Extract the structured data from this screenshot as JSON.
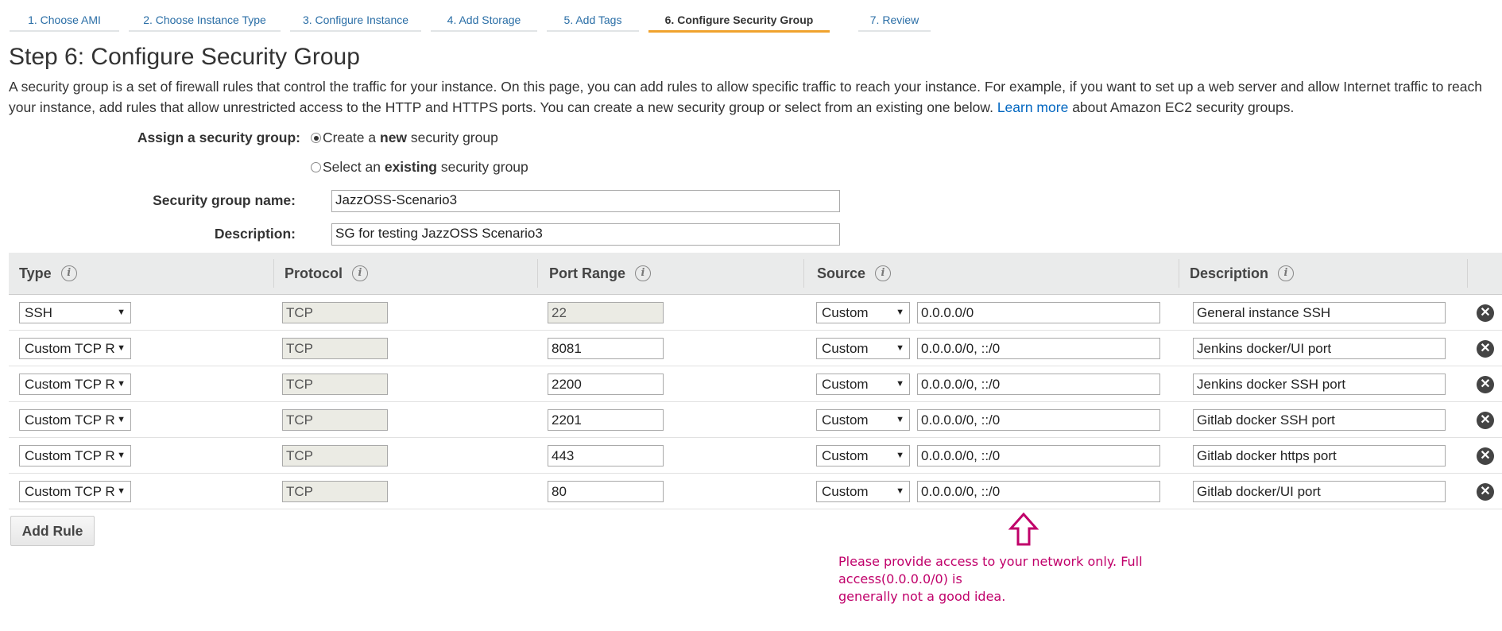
{
  "wizard": {
    "tabs": [
      {
        "label": "1. Choose AMI",
        "active": false
      },
      {
        "label": "2. Choose Instance Type",
        "active": false
      },
      {
        "label": "3. Configure Instance",
        "active": false
      },
      {
        "label": "4. Add Storage",
        "active": false
      },
      {
        "label": "5. Add Tags",
        "active": false
      },
      {
        "label": "6. Configure Security Group",
        "active": true
      },
      {
        "label": "7. Review",
        "active": false
      }
    ],
    "active_color": "#f0a32e"
  },
  "page": {
    "title": "Step 6: Configure Security Group",
    "intro_line1": "A security group is a set of firewall rules that control the traffic for your instance. On this page, you can add rules to allow specific traffic to reach your instance. For example, if you want to set up a web server and allow Internet traffic to reach",
    "intro_line2": "your instance, add rules that allow unrestricted access to the HTTP and HTTPS ports. You can create a new security group or select from an existing one below.",
    "learn_more": "Learn more",
    "intro_tail": "about Amazon EC2 security groups."
  },
  "assign": {
    "label": "Assign a security group:",
    "option_new_pre": "Create a ",
    "option_new_bold": "new",
    "option_new_post": " security group",
    "option_existing_pre": "Select an ",
    "option_existing_bold": "existing",
    "option_existing_post": " security group",
    "selected": "new"
  },
  "form": {
    "name_label": "Security group name:",
    "name_value": "JazzOSS-Scenario3",
    "desc_label": "Description:",
    "desc_value": "SG for testing JazzOSS Scenario3"
  },
  "table": {
    "headers": {
      "type": "Type",
      "protocol": "Protocol",
      "port_range": "Port Range",
      "source": "Source",
      "description": "Description"
    },
    "rows": [
      {
        "type": "SSH",
        "protocol": "TCP",
        "port": "22",
        "port_disabled": true,
        "source_type": "Custom",
        "source": "0.0.0.0/0",
        "description": "General instance SSH"
      },
      {
        "type": "Custom TCP R",
        "protocol": "TCP",
        "port": "8081",
        "port_disabled": false,
        "source_type": "Custom",
        "source": "0.0.0.0/0, ::/0",
        "description": "Jenkins docker/UI port"
      },
      {
        "type": "Custom TCP R",
        "protocol": "TCP",
        "port": "2200",
        "port_disabled": false,
        "source_type": "Custom",
        "source": "0.0.0.0/0, ::/0",
        "description": "Jenkins docker SSH port"
      },
      {
        "type": "Custom TCP R",
        "protocol": "TCP",
        "port": "2201",
        "port_disabled": false,
        "source_type": "Custom",
        "source": "0.0.0.0/0, ::/0",
        "description": "Gitlab docker SSH port"
      },
      {
        "type": "Custom TCP R",
        "protocol": "TCP",
        "port": "443",
        "port_disabled": false,
        "source_type": "Custom",
        "source": "0.0.0.0/0, ::/0",
        "description": "Gitlab docker https port"
      },
      {
        "type": "Custom TCP R",
        "protocol": "TCP",
        "port": "80",
        "port_disabled": false,
        "source_type": "Custom",
        "source": "0.0.0.0/0, ::/0",
        "description": "Gitlab docker/UI port"
      }
    ]
  },
  "add_rule_label": "Add Rule",
  "warning": {
    "line1": "Please provide access to your network only. Full access(0.0.0.0/0) is",
    "line2": "generally not a good idea.",
    "color": "#c0006a"
  },
  "icons": {
    "info": "info-icon",
    "remove": "remove-circle-icon",
    "dropdown": "dropdown-arrow-icon",
    "warning_arrow": "up-arrow-icon"
  }
}
